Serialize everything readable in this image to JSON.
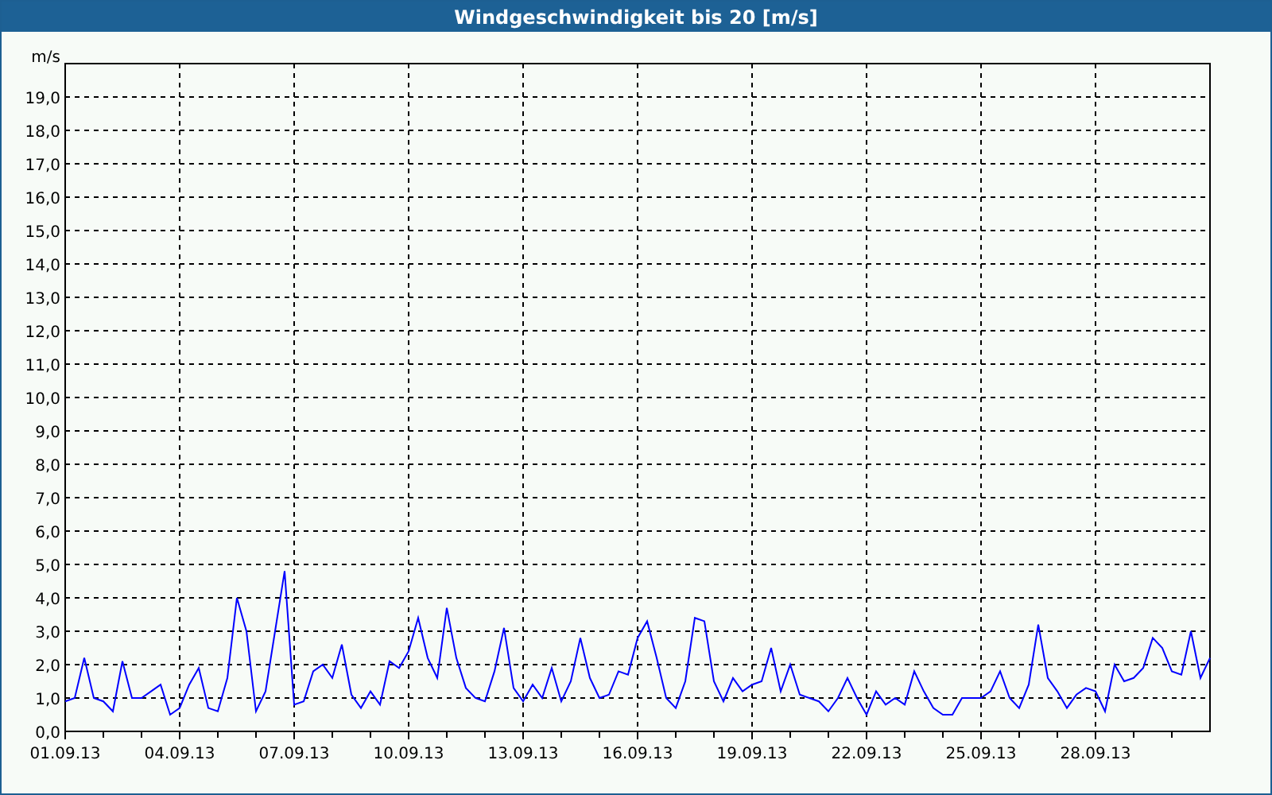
{
  "window": {
    "title": "Windgeschwindigkeit bis 20 [m/s]"
  },
  "chart": {
    "chart_data": {
      "type": "line",
      "grid": true,
      "ylabel": "m/s",
      "ylim": [
        0,
        20
      ],
      "categories": [
        "01.09.13",
        null,
        null,
        null,
        null,
        null,
        null,
        null,
        null,
        null,
        null,
        null,
        "04.09.13",
        null,
        null,
        null,
        null,
        null,
        null,
        null,
        null,
        null,
        null,
        null,
        "07.09.13",
        null,
        null,
        null,
        null,
        null,
        null,
        null,
        null,
        null,
        null,
        null,
        "10.09.13",
        null,
        null,
        null,
        null,
        null,
        null,
        null,
        null,
        null,
        null,
        null,
        "13.09.13",
        null,
        null,
        null,
        null,
        null,
        null,
        null,
        null,
        null,
        null,
        null,
        "16.09.13",
        null,
        null,
        null,
        null,
        null,
        null,
        null,
        null,
        null,
        null,
        null,
        "19.09.13",
        null,
        null,
        null,
        null,
        null,
        null,
        null,
        null,
        null,
        null,
        null,
        "22.09.13",
        null,
        null,
        null,
        null,
        null,
        null,
        null,
        null,
        null,
        null,
        null,
        "25.09.13",
        null,
        null,
        null,
        null,
        null,
        null,
        null,
        null,
        null,
        null,
        null,
        "28.09.13",
        null,
        null,
        null,
        null,
        null,
        null,
        null,
        null,
        null,
        null,
        null,
        null
      ],
      "yticks": [
        {
          "value": 0,
          "label": "0,0"
        },
        {
          "value": 1,
          "label": "1,0"
        },
        {
          "value": 2,
          "label": "2,0"
        },
        {
          "value": 3,
          "label": "3,0"
        },
        {
          "value": 4,
          "label": "4,0"
        },
        {
          "value": 5,
          "label": "5,0"
        },
        {
          "value": 6,
          "label": "6,0"
        },
        {
          "value": 7,
          "label": "7,0"
        },
        {
          "value": 8,
          "label": "8,0"
        },
        {
          "value": 9,
          "label": "9,0"
        },
        {
          "value": 10,
          "label": "10,0"
        },
        {
          "value": 11,
          "label": "11,0"
        },
        {
          "value": 12,
          "label": "12,0"
        },
        {
          "value": 13,
          "label": "13,0"
        },
        {
          "value": 14,
          "label": "14,0"
        },
        {
          "value": 15,
          "label": "15,0"
        },
        {
          "value": 16,
          "label": "16,0"
        },
        {
          "value": 17,
          "label": "17,0"
        },
        {
          "value": 18,
          "label": "18,0"
        },
        {
          "value": 19,
          "label": "19,0"
        }
      ],
      "series": [
        {
          "color": "#0000ff",
          "values": [
            0.9,
            1.0,
            2.2,
            1.0,
            0.9,
            0.6,
            2.1,
            1.0,
            1.0,
            1.2,
            1.4,
            0.5,
            0.7,
            1.4,
            1.9,
            0.7,
            0.6,
            1.6,
            4.0,
            3.0,
            0.6,
            1.2,
            3.0,
            4.8,
            0.8,
            0.9,
            1.8,
            2.0,
            1.6,
            2.6,
            1.1,
            0.7,
            1.2,
            0.8,
            2.1,
            1.9,
            2.4,
            3.4,
            2.2,
            1.6,
            3.7,
            2.2,
            1.3,
            1.0,
            0.9,
            1.8,
            3.1,
            1.3,
            0.9,
            1.4,
            1.0,
            1.9,
            0.9,
            1.5,
            2.8,
            1.6,
            1.0,
            1.1,
            1.8,
            1.7,
            2.8,
            3.3,
            2.2,
            1.0,
            0.7,
            1.5,
            3.4,
            3.3,
            1.5,
            0.9,
            1.6,
            1.2,
            1.4,
            1.5,
            2.5,
            1.2,
            2.0,
            1.1,
            1.0,
            0.9,
            0.6,
            1.0,
            1.6,
            1.0,
            0.5,
            1.2,
            0.8,
            1.0,
            0.8,
            1.8,
            1.2,
            0.7,
            0.5,
            0.5,
            1.0,
            1.0,
            1.0,
            1.2,
            1.8,
            1.0,
            0.7,
            1.4,
            3.2,
            1.6,
            1.2,
            0.7,
            1.1,
            1.3,
            1.2,
            0.6,
            2.0,
            1.5,
            1.6,
            1.9,
            2.8,
            2.5,
            1.8,
            1.7,
            3.0,
            1.6,
            2.2
          ]
        }
      ]
    }
  }
}
